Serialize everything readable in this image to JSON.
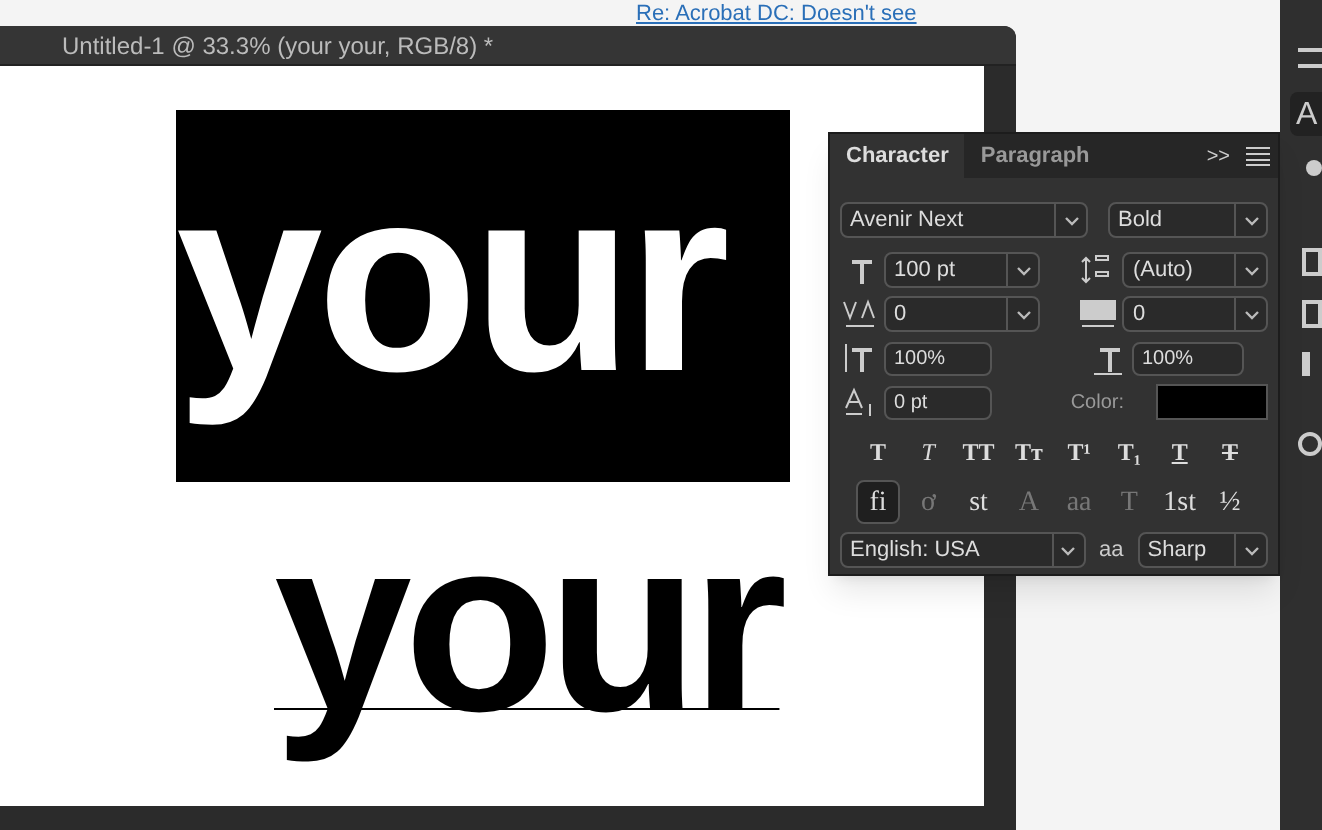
{
  "background_link": "Re: Acrobat DC: Doesn't see",
  "document": {
    "title": "Untitled-1 @ 33.3% (your your, RGB/8) *",
    "canvas_texts": [
      "your",
      "your"
    ]
  },
  "character_panel": {
    "tabs": [
      {
        "label": "Character",
        "selected": true
      },
      {
        "label": "Paragraph",
        "selected": false
      }
    ],
    "menu_glyph": ">>",
    "font_family": "Avenir Next",
    "font_style": "Bold",
    "font_size": "100 pt",
    "leading": "(Auto)",
    "kerning": "0",
    "tracking": "0",
    "vertical_scale": "100%",
    "horizontal_scale": "100%",
    "baseline_shift": "0 pt",
    "color_label": "Color:",
    "color": "#000000",
    "style_buttons": [
      {
        "glyph": "T",
        "kind": "bold"
      },
      {
        "glyph": "T",
        "kind": "italic"
      },
      {
        "glyph": "TT",
        "kind": "plain"
      },
      {
        "glyph": "Tᴛ",
        "kind": "plain"
      },
      {
        "glyph": "T¹",
        "kind": "plain"
      },
      {
        "glyph": "T₁",
        "kind": "plain"
      },
      {
        "glyph": "T",
        "kind": "underline"
      },
      {
        "glyph": "T",
        "kind": "strike"
      }
    ],
    "opentype_buttons": [
      {
        "glyph": "fi",
        "selected": true,
        "disabled": false
      },
      {
        "glyph": "ơ",
        "selected": false,
        "disabled": true
      },
      {
        "glyph": "st",
        "selected": false,
        "disabled": false
      },
      {
        "glyph": "A",
        "selected": false,
        "disabled": true
      },
      {
        "glyph": "aa",
        "selected": false,
        "disabled": true
      },
      {
        "glyph": "T",
        "selected": false,
        "disabled": true
      },
      {
        "glyph": "1st",
        "selected": false,
        "disabled": false
      },
      {
        "glyph": "½",
        "selected": false,
        "disabled": false
      }
    ],
    "language": "English: USA",
    "antialias_glyph": "aa",
    "antialias": "Sharp"
  },
  "tool_strip": {
    "label": "A"
  }
}
